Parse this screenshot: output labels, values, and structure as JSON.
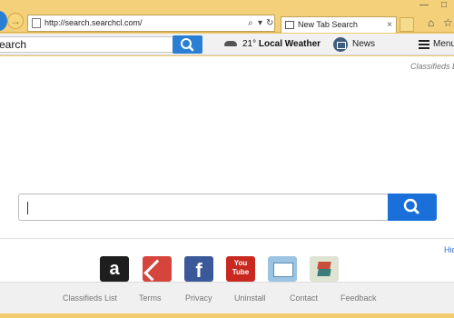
{
  "browser": {
    "url": "http://search.searchcl.com/",
    "tab_title": "New Tab Search",
    "tab_close": "×",
    "address_controls": [
      "⌕",
      "▾",
      "↻"
    ],
    "window_controls": [
      "—",
      "□"
    ],
    "tool_icons": [
      "⌂",
      "☆"
    ],
    "back_arrow": "→"
  },
  "toolbar": {
    "search_text": "earch",
    "temperature": "21°",
    "weather_label": "Local Weather",
    "news_label": "News",
    "menu_label": "Menu"
  },
  "page": {
    "corner_link": "Classifieds Li",
    "hide_link": "Hid",
    "tiles": {
      "amazon": "a",
      "facebook": "f",
      "youtube_top": "You",
      "youtube_bottom": "Tube"
    }
  },
  "footer": {
    "links": [
      "Classifieds List",
      "Terms",
      "Privacy",
      "Uninstall",
      "Contact",
      "Feedback"
    ]
  }
}
